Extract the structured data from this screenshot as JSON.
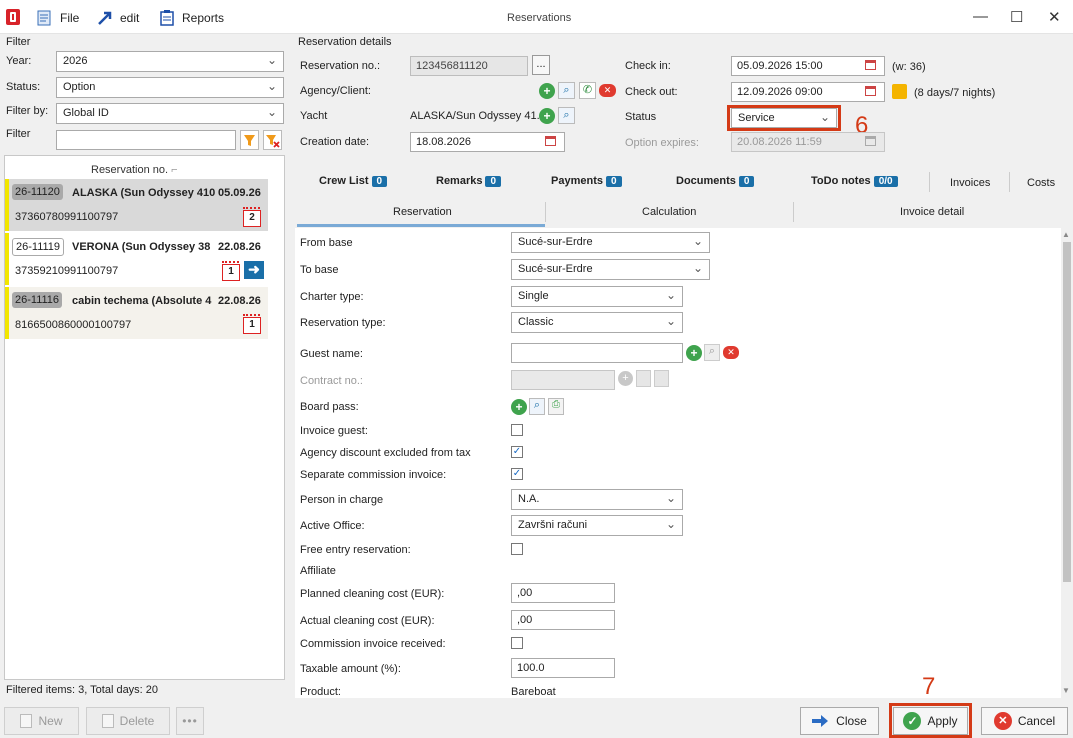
{
  "window": {
    "title": "Reservations"
  },
  "menu": {
    "file": "File",
    "edit": "edit",
    "reports": "Reports"
  },
  "filter": {
    "section_label": "Filter",
    "year_label": "Year:",
    "year_value": "2026",
    "status_label": "Status:",
    "status_value": "Option",
    "filter_by_label": "Filter by:",
    "filter_by_value": "Global ID",
    "filter_label": "Filter",
    "filter_value": ""
  },
  "list": {
    "header": "Reservation no.",
    "rows": [
      {
        "id": "26-11120",
        "title": "ALASKA (Sun Odyssey 410",
        "date": "05.09.26",
        "code": "37360780991100797",
        "days": "2"
      },
      {
        "id": "26-11119",
        "title": "VERONA (Sun Odyssey 38",
        "date": "22.08.26",
        "code": "37359210991100797",
        "days": "1"
      },
      {
        "id": "26-11116",
        "title": "cabin techema (Absolute 4",
        "date": "22.08.26",
        "code": "8166500860000100797",
        "days": "1"
      }
    ],
    "footer": "Filtered items: 3,  Total days: 20"
  },
  "details": {
    "section_label": "Reservation details",
    "reservation_no_label": "Reservation no.:",
    "reservation_no": "123456811120",
    "more": "...",
    "agency_label": "Agency/Client:",
    "yacht_label": "Yacht",
    "yacht": "ALASKA/Sun Odyssey 41...",
    "creation_date_label": "Creation date:",
    "creation_date": "18.08.2026",
    "checkin_label": "Check in:",
    "checkin": "05.09.2026 15:00",
    "week": "(w: 36)",
    "checkout_label": "Check out:",
    "checkout": "12.09.2026 09:00",
    "duration": "(8 days/7 nights)",
    "status_label": "Status",
    "status": "Service",
    "option_expires_label": "Option expires:",
    "option_expires": "20.08.2026 11:59"
  },
  "tabs_top": [
    {
      "label": "Crew List",
      "badge": "0"
    },
    {
      "label": "Remarks",
      "badge": "0"
    },
    {
      "label": "Payments",
      "badge": "0"
    },
    {
      "label": "Documents",
      "badge": "0"
    },
    {
      "label": "ToDo notes",
      "badge": "0/0"
    },
    {
      "label": "Invoices"
    },
    {
      "label": "Costs"
    }
  ],
  "tabs_sub": [
    "Reservation",
    "Calculation",
    "Invoice detail"
  ],
  "form": {
    "from_base_label": "From base",
    "from_base": "Sucé-sur-Erdre",
    "to_base_label": "To base",
    "to_base": "Sucé-sur-Erdre",
    "charter_type_label": "Charter type:",
    "charter_type": "Single",
    "reservation_type_label": "Reservation type:",
    "reservation_type": "Classic",
    "guest_name_label": "Guest name:",
    "guest_name": "",
    "contract_no_label": "Contract no.:",
    "board_pass_label": "Board pass:",
    "invoice_guest_label": "Invoice guest:",
    "agency_discount_label": "Agency discount excluded from tax",
    "separate_commission_label": "Separate commission invoice:",
    "person_in_charge_label": "Person in charge",
    "person_in_charge": "N.A.",
    "active_office_label": "Active Office:",
    "active_office": "Završni računi",
    "free_entry_label": "Free entry reservation:",
    "affiliate_label": "Affiliate",
    "planned_cleaning_label": "Planned cleaning cost (EUR):",
    "planned_cleaning": ",00",
    "actual_cleaning_label": "Actual cleaning cost (EUR):",
    "actual_cleaning": ",00",
    "commission_received_label": "Commission invoice received:",
    "taxable_label": "Taxable amount (%):",
    "taxable": "100.0",
    "product_label": "Product:",
    "product": "Bareboat"
  },
  "buttons": {
    "new": "New",
    "delete": "Delete",
    "close": "Close",
    "apply": "Apply",
    "cancel": "Cancel"
  },
  "annotations": {
    "step6": "6",
    "step7": "7"
  },
  "colors": {
    "accent": "#1a6fa8",
    "highlight": "#d43a16",
    "selected_row": "#d9d9d9",
    "marker_yellow": "#f2e600"
  }
}
